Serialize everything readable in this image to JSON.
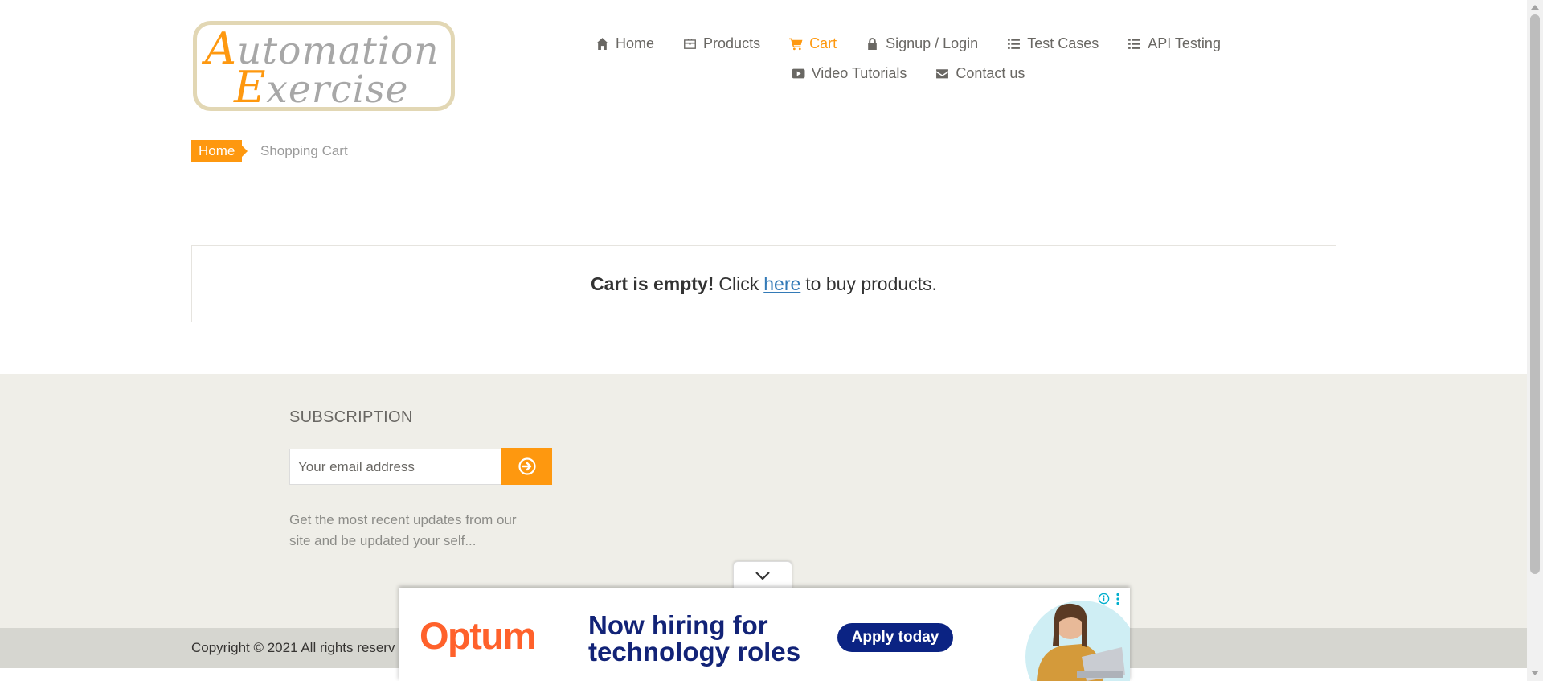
{
  "logo": {
    "line1_cap": "A",
    "line1_rest": "utomation",
    "line2_cap": "E",
    "line2_rest": "xercise"
  },
  "nav": {
    "row1": [
      {
        "label": "Home",
        "icon": "home-icon"
      },
      {
        "label": "Products",
        "icon": "briefcase-icon"
      },
      {
        "label": "Cart",
        "icon": "cart-icon",
        "active": true
      },
      {
        "label": "Signup / Login",
        "icon": "lock-icon"
      },
      {
        "label": "Test Cases",
        "icon": "list-icon"
      },
      {
        "label": "API Testing",
        "icon": "list-icon"
      }
    ],
    "row2": [
      {
        "label": "Video Tutorials",
        "icon": "youtube-play-icon"
      },
      {
        "label": "Contact us",
        "icon": "envelope-icon"
      }
    ]
  },
  "breadcrumb": {
    "home": "Home",
    "current": "Shopping Cart"
  },
  "cart": {
    "empty_bold": "Cart is empty!",
    "click": "Click",
    "link": "here",
    "suffix": "to buy products."
  },
  "subscription": {
    "title": "SUBSCRIPTION",
    "placeholder": "Your email address",
    "button_icon": "arrow-circle-right-icon",
    "description": "Get the most recent updates from our site and be updated your self..."
  },
  "footer": {
    "copyright": "Copyright © 2021 All rights reserv"
  },
  "ad": {
    "brand": "Optum",
    "headline": "Now hiring for technology roles",
    "cta": "Apply today",
    "toggle_icon": "chevron-down-icon",
    "info_icon": "info-icon",
    "menu_icon": "more-vertical-icon"
  },
  "colors": {
    "accent": "#fe980f",
    "footer_bg": "#efeee8",
    "ad_brand": "#ff612b",
    "ad_navy": "#122377"
  }
}
